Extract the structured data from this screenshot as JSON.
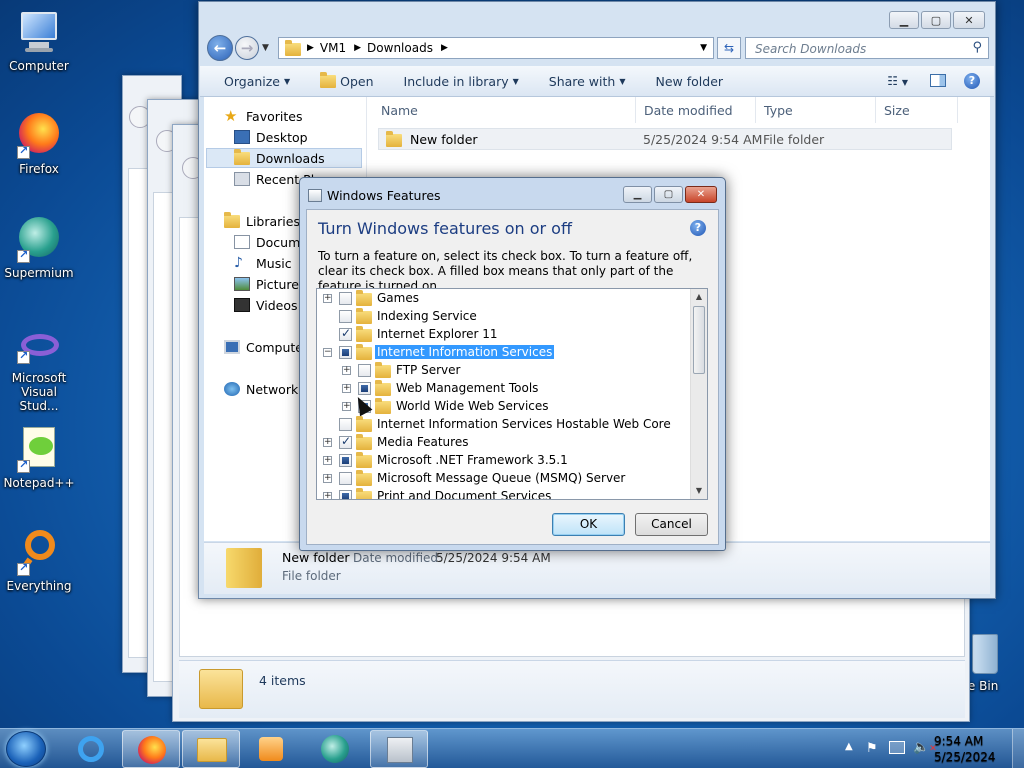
{
  "desktop": {
    "icons": [
      {
        "label": "Computer"
      },
      {
        "label": "Firefox"
      },
      {
        "label": "Supermium"
      },
      {
        "label": "Microsoft Visual Stud..."
      },
      {
        "label": "Notepad++"
      },
      {
        "label": "Everything"
      },
      {
        "label": "cle Bin"
      }
    ]
  },
  "explorer": {
    "breadcrumb": [
      "VM1",
      "Downloads"
    ],
    "search_placeholder": "Search Downloads",
    "toolbar": {
      "organize": "Organize",
      "open": "Open",
      "include": "Include in library",
      "share": "Share with",
      "new_folder": "New folder"
    },
    "nav": {
      "favorites": "Favorites",
      "desktop": "Desktop",
      "downloads": "Downloads",
      "recent": "Recent Pl",
      "libraries": "Libraries",
      "documents": "Docume",
      "music": "Music",
      "pictures": "Pictures",
      "videos": "Videos",
      "computer": "Compute",
      "network": "Network"
    },
    "columns": {
      "name": "Name",
      "date": "Date modified",
      "type": "Type",
      "size": "Size"
    },
    "files": [
      {
        "name": "New folder",
        "date": "5/25/2024 9:54 AM",
        "type": "File folder",
        "size": ""
      }
    ],
    "details": {
      "name": "New folder",
      "date_label": "Date modified:",
      "date_value": "5/25/2024 9:54 AM",
      "type": "File folder"
    }
  },
  "back_window": {
    "status": "4 items"
  },
  "dialog": {
    "title": "Windows Features",
    "heading": "Turn Windows features on or off",
    "description": "To turn a feature on, select its check box. To turn a feature off, clear its check box. A filled box means that only part of the feature is turned on.",
    "features": [
      {
        "label": "Games",
        "state": "unchecked",
        "expander": "+",
        "indent": 0
      },
      {
        "label": "Indexing Service",
        "state": "unchecked",
        "expander": "",
        "indent": 0
      },
      {
        "label": "Internet Explorer 11",
        "state": "checked",
        "expander": "",
        "indent": 0
      },
      {
        "label": "Internet Information Services",
        "state": "partial",
        "expander": "−",
        "indent": 0,
        "selected": true
      },
      {
        "label": "FTP Server",
        "state": "unchecked",
        "expander": "+",
        "indent": 1
      },
      {
        "label": "Web Management Tools",
        "state": "partial",
        "expander": "+",
        "indent": 1
      },
      {
        "label": "World Wide Web Services",
        "state": "partial",
        "expander": "+",
        "indent": 1
      },
      {
        "label": "Internet Information Services Hostable Web Core",
        "state": "unchecked",
        "expander": "",
        "indent": 0
      },
      {
        "label": "Media Features",
        "state": "checked",
        "expander": "+",
        "indent": 0
      },
      {
        "label": "Microsoft .NET Framework 3.5.1",
        "state": "partial",
        "expander": "+",
        "indent": 0
      },
      {
        "label": "Microsoft Message Queue (MSMQ) Server",
        "state": "unchecked",
        "expander": "+",
        "indent": 0
      },
      {
        "label": "Print and Document Services",
        "state": "partial",
        "expander": "+",
        "indent": 0
      }
    ],
    "ok": "OK",
    "cancel": "Cancel"
  },
  "taskbar": {
    "time": "9:54 AM",
    "date": "5/25/2024"
  },
  "colors": {
    "selection": "#3399ff",
    "heading": "#1c3d82",
    "desktop": "#1565b6"
  }
}
